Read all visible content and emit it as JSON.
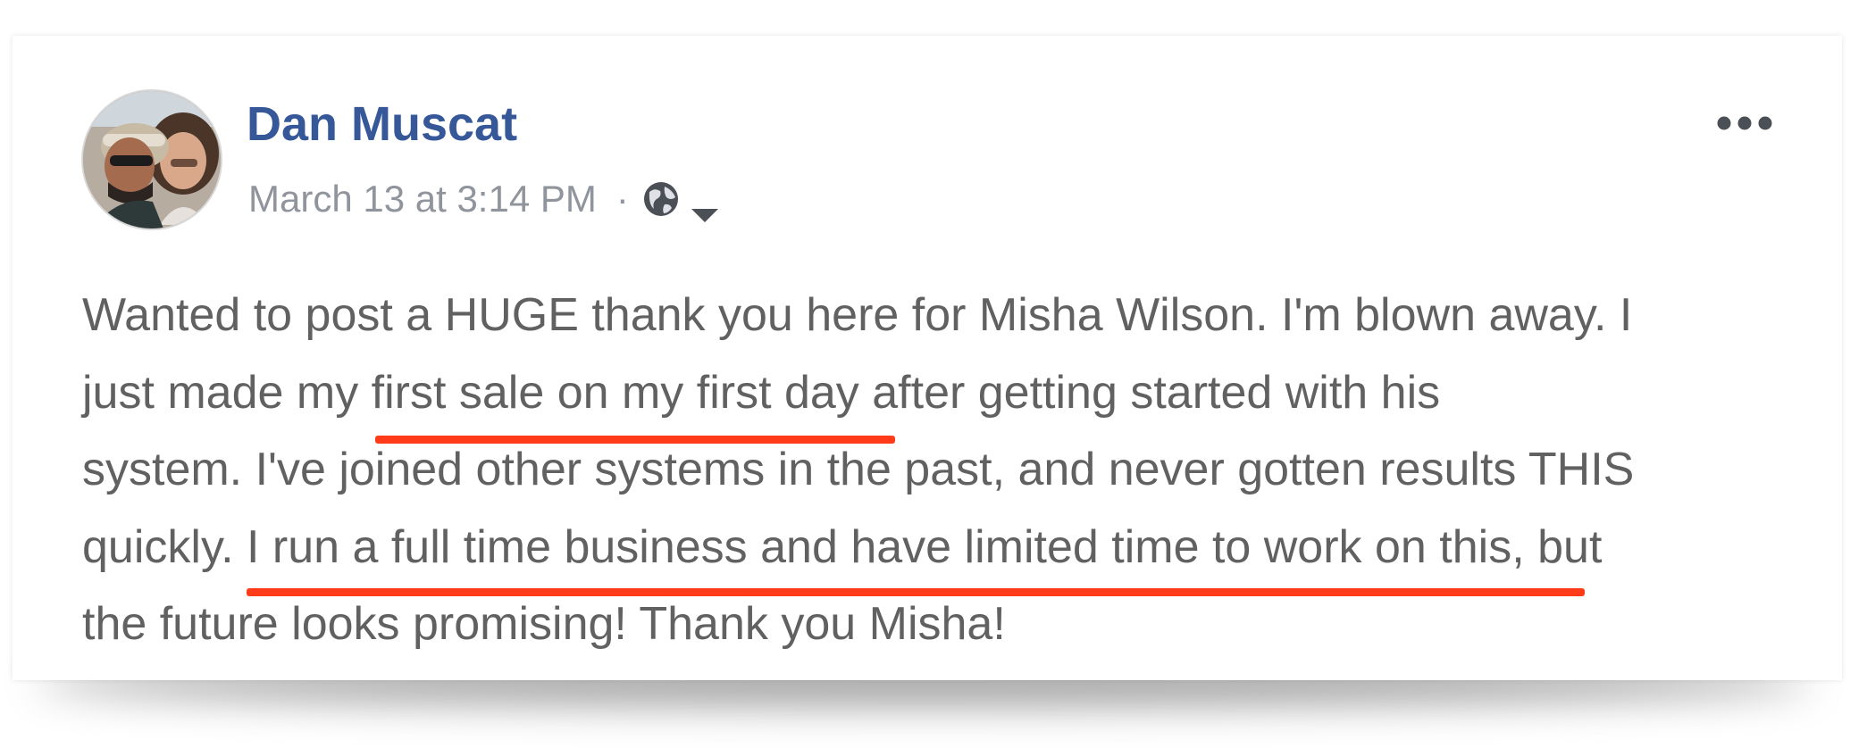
{
  "post": {
    "author": "Dan Muscat",
    "timestamp": "March 13 at 3:14 PM",
    "separator": "·",
    "privacy_icon": "globe-icon",
    "privacy_menu_icon": "caret-down-icon",
    "options_icon": "more-options-icon",
    "body_lines": [
      {
        "text": "Wanted to post a HUGE thank you here for Misha Wilson. I'm blown away. I"
      },
      {
        "pre": "just made my ",
        "highlight": "first sale on my first day",
        "post": " after getting started with his"
      },
      {
        "text": "system. I've joined other systems in the past, and never gotten results THIS"
      },
      {
        "pre": "quickly. ",
        "highlight": "I run a full time business and have limited time to work on this,",
        "post": " but"
      },
      {
        "text": "the future looks promising! Thank you Misha!"
      }
    ]
  },
  "colors": {
    "author_link": "#365899",
    "meta_text": "#90949c",
    "body_text": "#616161",
    "highlight_underline": "#ff3b1a"
  }
}
